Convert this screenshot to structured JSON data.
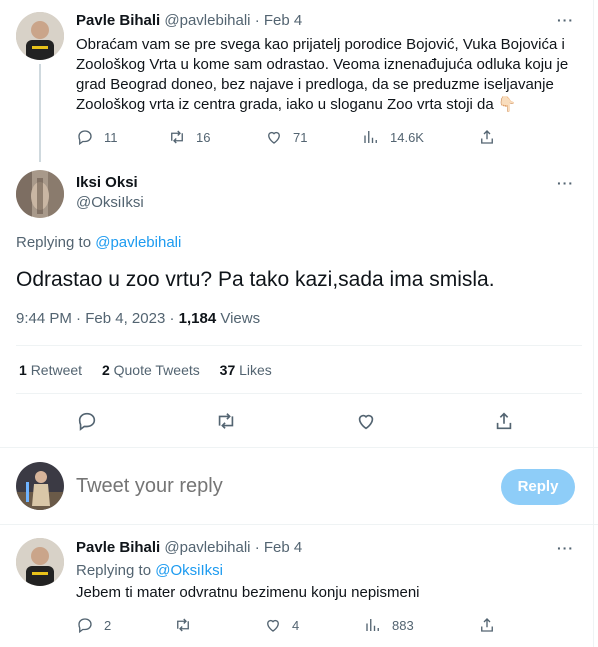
{
  "parent_tweet": {
    "author_name": "Pavle Bihali",
    "author_handle": "@pavlebihali",
    "time_sep": "·",
    "date": "Feb 4",
    "text_lines": [
      "Obraćam vam se pre svega kao prijatelj porodice Bojović, Vuka Bojovića i",
      "Zoološkog Vrta u kome sam odrastao. Veoma iznenađujuća odluka koju je",
      "grad Beograd doneo, bez najave i predloga, da se preduzme iseljavanje",
      "Zoološkog vrta iz centra grada, iako u sloganu Zoo vrta stoji da 👇🏻"
    ],
    "replies": "11",
    "retweets": "16",
    "likes": "71",
    "views": "14.6K"
  },
  "main_tweet": {
    "author_name": "Iksi Oksi",
    "author_handle": "@OksiIksi",
    "replying_prefix": "Replying to",
    "replying_to": "@pavlebihali",
    "text": "Odrastao u zoo vrtu? Pa tako kazi,sada ima smisla.",
    "time": "9:44 PM",
    "time_sep": "·",
    "date": "Feb 4, 2023",
    "date_sep": "·",
    "views_count": "1,184",
    "views_label": "Views",
    "retweets_count": "1",
    "retweets_label": "Retweet",
    "quotes_count": "2",
    "quotes_label": "Quote Tweets",
    "likes_count": "37",
    "likes_label": "Likes"
  },
  "composer": {
    "placeholder": "Tweet your reply",
    "button_label": "Reply"
  },
  "reply_tweet": {
    "author_name": "Pavle Bihali",
    "author_handle": "@pavlebihali",
    "time_sep": "·",
    "date": "Feb 4",
    "replying_prefix": "Replying to",
    "replying_to": "@OksiIksi",
    "text": "Jebem ti mater odvratnu bezimenu konju nepismeni",
    "replies": "2",
    "retweets": "",
    "likes": "4",
    "views": "883"
  },
  "more_symbol": "···",
  "colors": {
    "accent": "#1d9bf0",
    "reply_button_disabled": "#8ecdf8",
    "muted_text": "#536471",
    "divider": "#eff3f4"
  }
}
